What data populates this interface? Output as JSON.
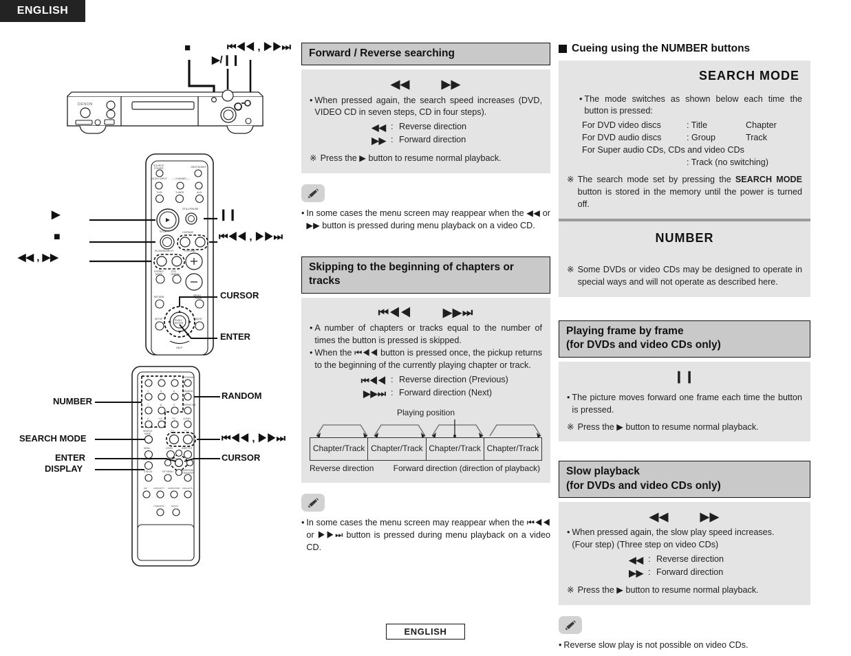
{
  "header": {
    "language_tab": "ENGLISH"
  },
  "footer": {
    "language": "ENGLISH"
  },
  "left_column": {
    "unit_callouts": [
      {
        "name": "stop",
        "label": "■"
      },
      {
        "name": "play-pause",
        "label": "▶/❙❙"
      },
      {
        "name": "skip",
        "label": "⏮◀◀ , ▶▶⏭"
      }
    ],
    "remote_top_callouts": [
      {
        "name": "play",
        "label": "▶"
      },
      {
        "name": "still-pause",
        "label": "❙❙"
      },
      {
        "name": "stop",
        "label": "■"
      },
      {
        "name": "skip",
        "label": "⏮◀◀ , ▶▶⏭"
      },
      {
        "name": "search",
        "label": "◀◀ , ▶▶"
      },
      {
        "name": "cursor",
        "label": "CURSOR"
      },
      {
        "name": "enter",
        "label": "ENTER"
      }
    ],
    "remote_bottom_callouts": [
      {
        "name": "number",
        "label": "NUMBER"
      },
      {
        "name": "random",
        "label": "RANDOM"
      },
      {
        "name": "search-mode",
        "label": "SEARCH MODE"
      },
      {
        "name": "skip",
        "label": "⏮◀◀ , ▶▶⏭"
      },
      {
        "name": "enter",
        "label": "ENTER"
      },
      {
        "name": "cursor",
        "label": "CURSOR"
      },
      {
        "name": "display",
        "label": "DISPLAY"
      }
    ],
    "brand": "DENON"
  },
  "forward_reverse": {
    "heading": "Forward / Reverse searching",
    "icon_left": "◀◀",
    "icon_right": "▶▶",
    "bullet_dot": "•",
    "bullet": "When pressed again, the search speed increases (DVD, VIDEO CD in seven steps, CD in four steps).",
    "def_reverse_sym": "◀◀",
    "def_reverse_val": "Reverse direction",
    "def_forward_sym": "▶▶",
    "def_forward_val": "Forward direction",
    "colon": ":",
    "note_mark": "※",
    "note": "Press the ▶ button to resume normal playback.",
    "memo_dot": "•",
    "memo": "In some cases the menu screen may reappear when the ◀◀ or ▶▶ button is pressed during menu playback on a video CD."
  },
  "skipping": {
    "heading": "Skipping to the beginning of chapters or tracks",
    "icon_left": "⏮◀◀",
    "icon_right": "▶▶⏭",
    "bullet_dot": "•",
    "bullet1": "A number of chapters or tracks equal to the number of times the button is pressed is skipped.",
    "bullet2": "When the ⏮◀◀ button is pressed once, the pickup returns to the beginning of the currently playing chapter or track.",
    "def_reverse_sym": "⏮◀◀",
    "def_reverse_val": "Reverse direction (Previous)",
    "def_forward_sym": "▶▶⏭",
    "def_forward_val": "Forward direction (Next)",
    "colon": ":",
    "diagram": {
      "playing_position_label": "Playing position",
      "cells": [
        "Chapter/Track",
        "Chapter/Track",
        "Chapter/Track",
        "Chapter/Track"
      ],
      "reverse_label": "Reverse direction",
      "forward_label": "Forward direction (direction of playback)"
    },
    "memo_dot": "•",
    "memo": "In some cases the menu screen may reappear when the ⏮◀◀ or ▶▶⏭ button is pressed during menu playback on a video CD."
  },
  "cueing": {
    "heading": "Cueing using the NUMBER buttons",
    "search_mode_title": "SEARCH  MODE",
    "bullet_dot": "•",
    "bullet": "The mode switches as shown below each time the button is pressed:",
    "rows": [
      {
        "name": "For DVD video discs",
        "a": ": Title",
        "b": "Chapter"
      },
      {
        "name": "For DVD audio  discs",
        "a": ": Group",
        "b": "Track"
      }
    ],
    "row3_line1": "For Super audio CDs, CDs and video CDs",
    "row3_line2": ": Track (no switching)",
    "note_mark": "※",
    "note_pre": "The search mode set by pressing the ",
    "note_bold": "SEARCH MODE",
    "note_post": " button is stored in the memory until the power is turned off.",
    "number_title": "NUMBER",
    "number_note_mark": "※",
    "number_note": "Some DVDs or video CDs may be designed to operate in special ways and will not operate as described here."
  },
  "frame_by_frame": {
    "heading_line1": "Playing frame by frame",
    "heading_line2": "(for DVDs and video CDs only)",
    "icon": "❙❙",
    "bullet_dot": "•",
    "bullet": "The picture moves forward one frame each time the button is pressed.",
    "note_mark": "※",
    "note": "Press the ▶ button to resume normal playback."
  },
  "slow_playback": {
    "heading_line1": "Slow playback",
    "heading_line2": "(for DVDs and video CDs only)",
    "icon_left": "◀◀",
    "icon_right": "▶▶",
    "bullet_dot": "•",
    "bullet_line1": "When pressed again, the slow play speed increases.",
    "bullet_line2": "(Four step) (Three step on video CDs)",
    "def_reverse_sym": "◀◀",
    "def_reverse_val": "Reverse direction",
    "def_forward_sym": "▶▶",
    "def_forward_val": "Forward direction",
    "colon": ":",
    "note_mark": "※",
    "note": "Press the ▶ button to resume normal playback.",
    "memo_dot": "•",
    "memo": "Reverse slow play is not possible on video CDs."
  },
  "colors": {
    "heading_bg": "#c9c9c9",
    "panel_bg": "#e4e4e4",
    "ink": "#111111",
    "tab_bg": "#232323",
    "divider": "#9a9a9a"
  }
}
